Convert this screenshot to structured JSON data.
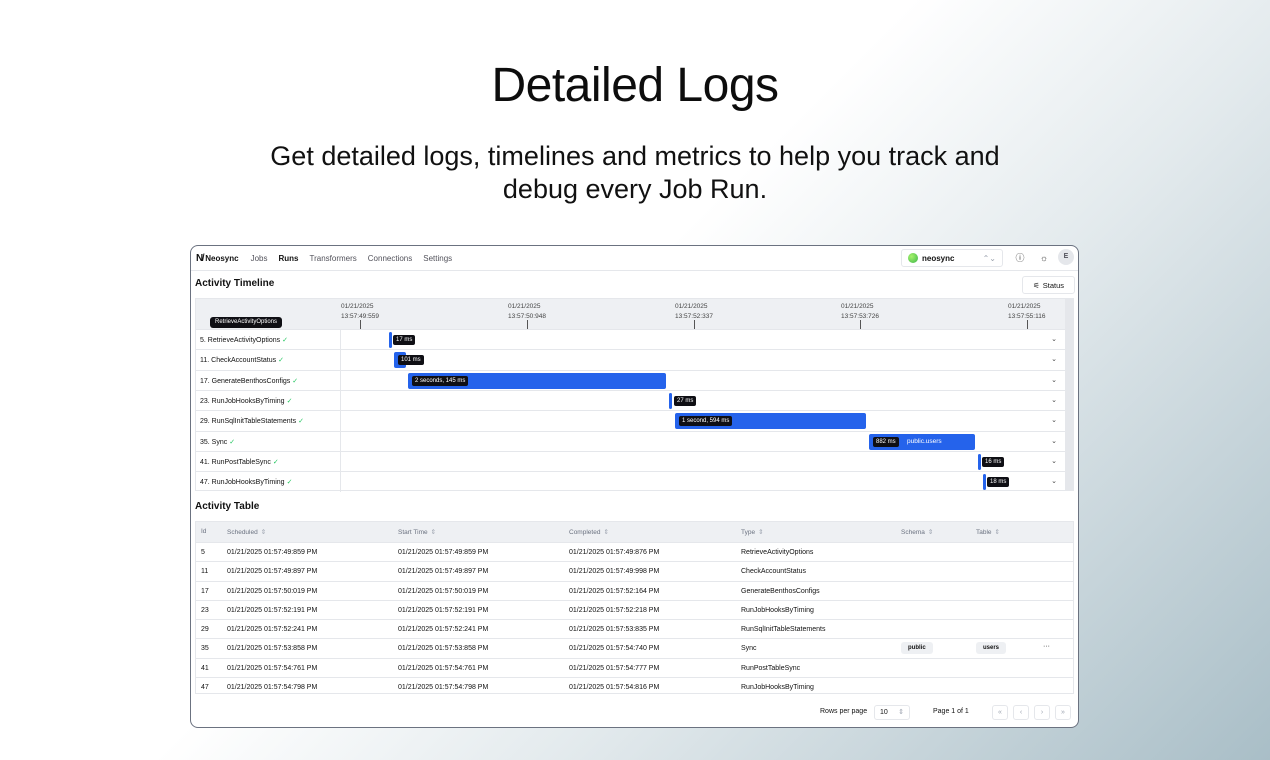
{
  "hero": {
    "title": "Detailed Logs",
    "subtitle": "Get detailed logs, timelines and metrics to help you track and debug every Job Run."
  },
  "nav": {
    "brand": "Neosync",
    "links": [
      "Jobs",
      "Runs",
      "Transformers",
      "Connections",
      "Settings"
    ],
    "active": "Runs",
    "org": "neosync",
    "avatar": "E"
  },
  "timeline": {
    "title": "Activity Timeline",
    "status_button": "Status",
    "tooltip": "RetrieveActivityOptions",
    "ticks": [
      {
        "date": "01/21/2025",
        "time": "13:57:49:559"
      },
      {
        "date": "01/21/2025",
        "time": "13:57:50:948"
      },
      {
        "date": "01/21/2025",
        "time": "13:57:52:337"
      },
      {
        "date": "01/21/2025",
        "time": "13:57:53:726"
      },
      {
        "date": "01/21/2025",
        "time": "13:57:55:116"
      }
    ],
    "rows": [
      {
        "label": "5.  RetrieveActivityOptions",
        "duration": "17 ms"
      },
      {
        "label": "11.  CheckAccountStatus",
        "duration": "101 ms"
      },
      {
        "label": "17.  GenerateBenthosConfigs",
        "duration": "2 seconds, 145 ms"
      },
      {
        "label": "23.  RunJobHooksByTiming",
        "duration": "27 ms"
      },
      {
        "label": "29.  RunSqlInitTableStatements",
        "duration": "1 second, 594 ms"
      },
      {
        "label": "35.  Sync",
        "duration": "882 ms",
        "tag": "public.users"
      },
      {
        "label": "41.  RunPostTableSync",
        "duration": "16 ms"
      },
      {
        "label": "47.  RunJobHooksByTiming",
        "duration": "18 ms"
      }
    ]
  },
  "table": {
    "title": "Activity Table",
    "headers": [
      "Id",
      "Scheduled",
      "Start Time",
      "Completed",
      "Type",
      "Schema",
      "Table"
    ],
    "rows": [
      {
        "id": "5",
        "scheduled": "01/21/2025 01:57:49:859 PM",
        "start": "01/21/2025 01:57:49:859 PM",
        "completed": "01/21/2025 01:57:49:876 PM",
        "type": "RetrieveActivityOptions",
        "schema": "",
        "table": ""
      },
      {
        "id": "11",
        "scheduled": "01/21/2025 01:57:49:897 PM",
        "start": "01/21/2025 01:57:49:897 PM",
        "completed": "01/21/2025 01:57:49:998 PM",
        "type": "CheckAccountStatus",
        "schema": "",
        "table": ""
      },
      {
        "id": "17",
        "scheduled": "01/21/2025 01:57:50:019 PM",
        "start": "01/21/2025 01:57:50:019 PM",
        "completed": "01/21/2025 01:57:52:164 PM",
        "type": "GenerateBenthosConfigs",
        "schema": "",
        "table": ""
      },
      {
        "id": "23",
        "scheduled": "01/21/2025 01:57:52:191 PM",
        "start": "01/21/2025 01:57:52:191 PM",
        "completed": "01/21/2025 01:57:52:218 PM",
        "type": "RunJobHooksByTiming",
        "schema": "",
        "table": ""
      },
      {
        "id": "29",
        "scheduled": "01/21/2025 01:57:52:241 PM",
        "start": "01/21/2025 01:57:52:241 PM",
        "completed": "01/21/2025 01:57:53:835 PM",
        "type": "RunSqlInitTableStatements",
        "schema": "",
        "table": ""
      },
      {
        "id": "35",
        "scheduled": "01/21/2025 01:57:53:858 PM",
        "start": "01/21/2025 01:57:53:858 PM",
        "completed": "01/21/2025 01:57:54:740 PM",
        "type": "Sync",
        "schema": "public",
        "table": "users",
        "more": "···"
      },
      {
        "id": "41",
        "scheduled": "01/21/2025 01:57:54:761 PM",
        "start": "01/21/2025 01:57:54:761 PM",
        "completed": "01/21/2025 01:57:54:777 PM",
        "type": "RunPostTableSync",
        "schema": "",
        "table": ""
      },
      {
        "id": "47",
        "scheduled": "01/21/2025 01:57:54:798 PM",
        "start": "01/21/2025 01:57:54:798 PM",
        "completed": "01/21/2025 01:57:54:816 PM",
        "type": "RunJobHooksByTiming",
        "schema": "",
        "table": ""
      }
    ],
    "pagination": {
      "rows_per_page_label": "Rows per page",
      "rows_per_page": "10",
      "page_info": "Page 1 of 1"
    }
  }
}
